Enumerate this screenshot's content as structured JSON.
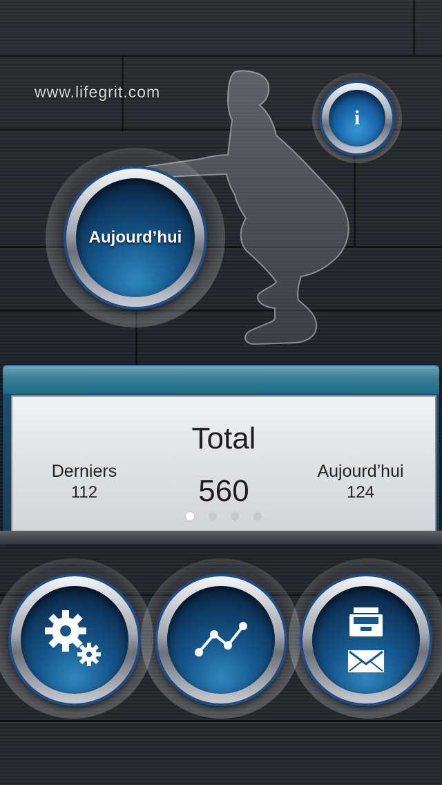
{
  "header": {
    "website": "www.lifegrit.com"
  },
  "today_button": {
    "label": "Aujourd’hui"
  },
  "info_button": {
    "glyph": "i"
  },
  "stats": {
    "title": "Total",
    "total_value": "560",
    "left": {
      "label": "Derniers",
      "value": "112"
    },
    "right": {
      "label": "Aujourd’hui",
      "value": "124"
    },
    "page_indicator": {
      "pages": 4,
      "current": 1
    }
  },
  "bottom_buttons": [
    {
      "icon": "gears-icon"
    },
    {
      "icon": "line-chart-icon"
    },
    {
      "icon": "inbox-mail-icon"
    }
  ],
  "colors": {
    "accent_blue": "#15578c",
    "ring_border": "#1c4d86",
    "panel_bg": "#dfe1e3"
  }
}
